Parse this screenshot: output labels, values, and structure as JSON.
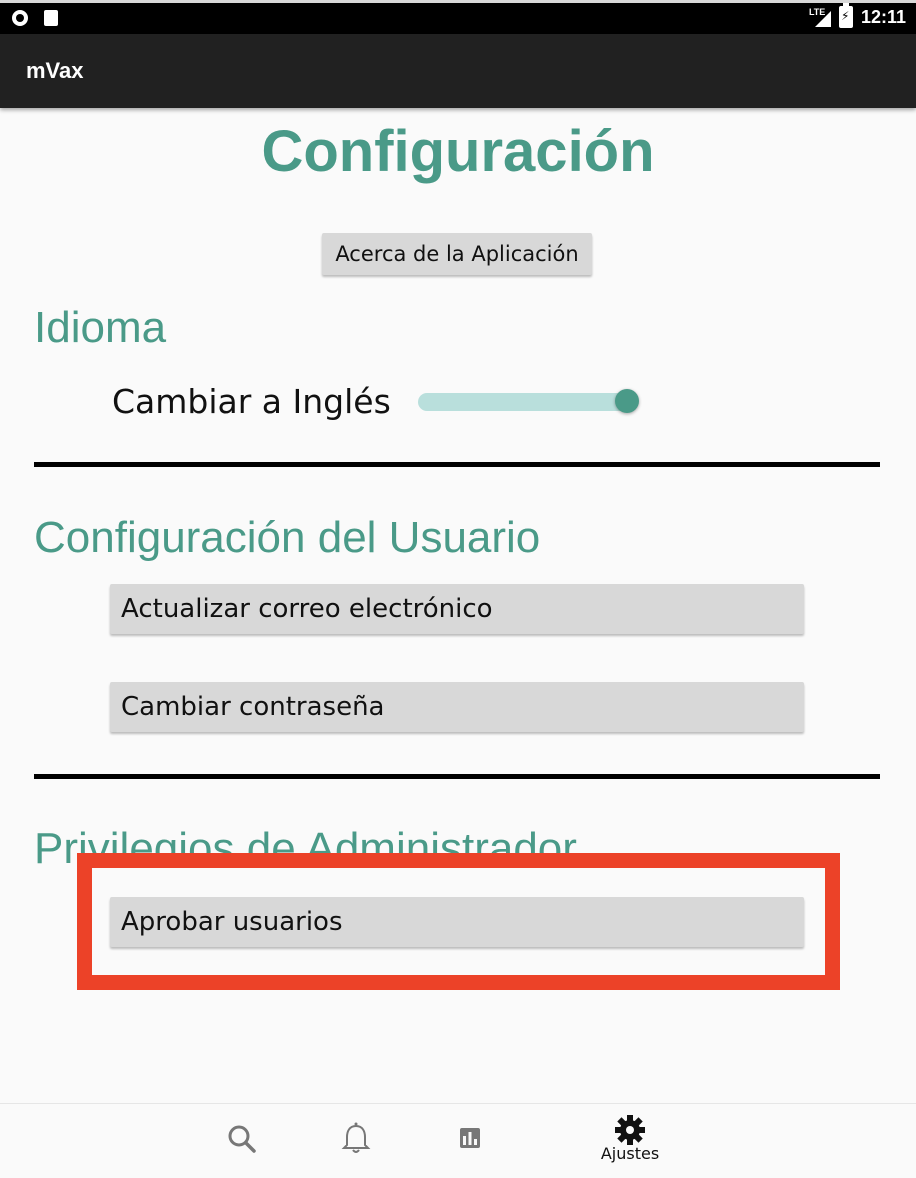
{
  "status_bar": {
    "time": "12:11",
    "network": "LTE"
  },
  "app_bar": {
    "title": "mVax"
  },
  "page": {
    "title": "Configuración",
    "about_button": "Acerca de la Aplicación"
  },
  "language": {
    "section_title": "Idioma",
    "toggle_label": "Cambiar a Inglés",
    "toggle_on": true
  },
  "user": {
    "section_title": "Configuración del Usuario",
    "update_email_button": "Actualizar correo electrónico",
    "change_password_button": "Cambiar contraseña"
  },
  "admin": {
    "section_title": "Privilegios de Administrador",
    "approve_users_button": "Aprobar usuarios"
  },
  "bottom_nav": {
    "items": [
      {
        "icon": "search-icon",
        "label": ""
      },
      {
        "icon": "bell-icon",
        "label": ""
      },
      {
        "icon": "bar-chart-icon",
        "label": ""
      },
      {
        "icon": "gear-icon",
        "label": "Ajustes"
      }
    ]
  },
  "colors": {
    "accent": "#4a9a88",
    "highlight_box": "#ec4228",
    "app_bar": "#212121"
  }
}
